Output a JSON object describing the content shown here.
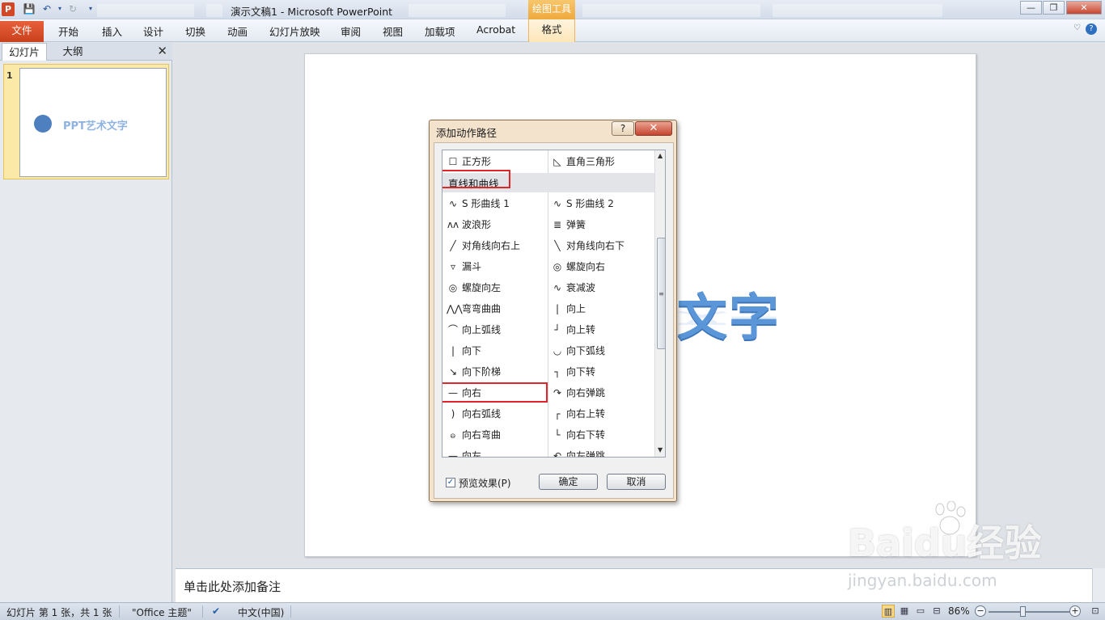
{
  "window": {
    "title": "演示文稿1 - Microsoft PowerPoint",
    "context_tools": "绘图工具",
    "min": "—",
    "restore": "❐",
    "close": "✕"
  },
  "ribbon": {
    "file": "文件",
    "tabs": [
      "开始",
      "插入",
      "设计",
      "切换",
      "动画",
      "幻灯片放映",
      "审阅",
      "视图",
      "加载项",
      "Acrobat"
    ],
    "format": "格式"
  },
  "left_pane": {
    "tab_slides": "幻灯片",
    "tab_outline": "大纲",
    "slide_number": "1",
    "thumb_text": "PPT艺术文字"
  },
  "slide": {
    "art_text": "文字"
  },
  "notes": {
    "placeholder": "单击此处添加备注"
  },
  "status": {
    "slide_info": "幻灯片 第 1 张，共 1 张",
    "theme": "\"Office 主题\"",
    "language": "中文(中国)",
    "zoom": "86%"
  },
  "dialog": {
    "title": "添加动作路径",
    "help": "?",
    "close": "✕",
    "section": "直线和曲线",
    "top_left": "正方形",
    "top_right": "直角三角形",
    "items_left": [
      "S 形曲线 1",
      "波浪形",
      "对角线向右上",
      "漏斗",
      "螺旋向左",
      "弯弯曲曲",
      "向上弧线",
      "向下",
      "向下阶梯",
      "向右",
      "向右弧线",
      "向右弯曲",
      "向左"
    ],
    "items_right": [
      "S 形曲线 2",
      "弹簧",
      "对角线向右下",
      "螺旋向右",
      "衰减波",
      "向上",
      "向上转",
      "向下弧线",
      "向下转",
      "向右弹跳",
      "向右上转",
      "向右下转",
      "向左弹跳"
    ],
    "preview_label": "预览效果(P)",
    "ok": "确定",
    "cancel": "取消"
  },
  "watermark": {
    "brand": "Baidu经验",
    "url": "jingyan.baidu.com"
  }
}
